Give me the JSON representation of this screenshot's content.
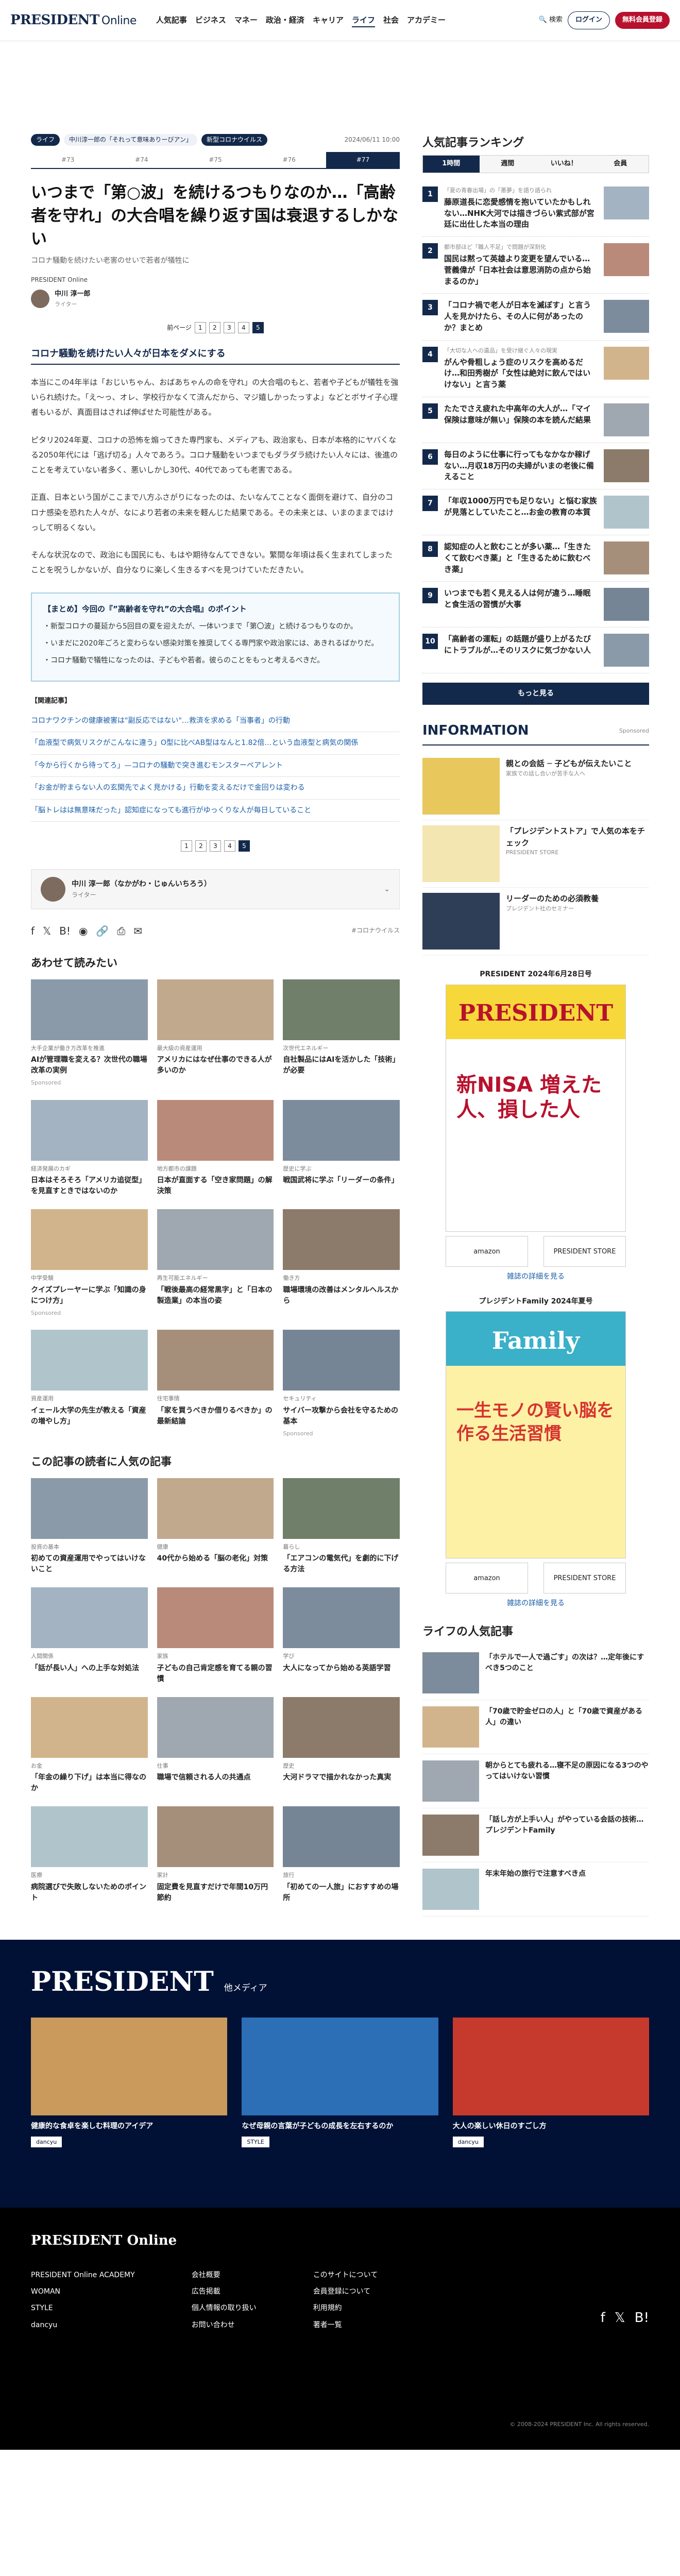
{
  "header": {
    "logo": "PRESIDENT",
    "logo_sub": "Online",
    "nav": [
      "人気記事",
      "ビジネス",
      "マネー",
      "政治・経済",
      "キャリア",
      "ライフ",
      "社会",
      "アカデミー"
    ],
    "nav_active": "ライフ",
    "search": "検索",
    "login": "ログイン",
    "register": "無料会員登録"
  },
  "article": {
    "tags": [
      "ライフ",
      "中川淳一郎の「それって意味ありーびアン」",
      "新型コロナウイルス"
    ],
    "date": "2024/06/11 10:00",
    "page_tabs": [
      "#73",
      "#74",
      "#75",
      "#76",
      "#77"
    ],
    "title": "いつまで「第○波」を続けるつもりなのか…「高齢者を守れ」の大合唱を繰り返す国は衰退するしかない",
    "subtitle": "コロナ騒動を続けたい老害のせいで若者が犠牲に",
    "source": "PRESIDENT Online",
    "author_name": "中川 淳一郎",
    "author_role": "ライター",
    "pager_prev": "前ページ",
    "pages": [
      "1",
      "2",
      "3",
      "4",
      "5"
    ],
    "h2": "コロナ騒動を続けたい人々が日本をダメにする",
    "paragraphs": [
      "本当にこの4年半は「おじいちゃん、おばあちゃんの命を守れ」の大合唱のもと、若者や子どもが犠牲を強いられ続けた。「え〜っ、オレ、学校行かなくて済んだから、マジ嬉しかったっすよ」などとボサイ子心理者もいるが、真面目はされば伸ばせた可能性がある。",
      "ピタリ2024年夏、コロナの恐怖を煽ってきた専門家も、メディアも、政治家も、日本が本格的にヤバくなる2050年代には「逃げ切る」人々であろう。コロナ騒動をいつまでもダラダラ続けたい人々には、後進のことを考えていない者多く、悪いしかし30代、40代であっても老害である。",
      "正直、日本という国がここまで八方ふさがりになったのは、たいなんてことなく面倒を避けて、自分のコロナ感染を恐れた人々が、なにより若者の未来を軽んじた結果である。その未来とは、いまのままではけっして明るくない。",
      "そんな状況なので、政治にも国民にも、もはや期待なんてできない。繁間な年頃は長く生まれてしまったことを呪うしかないが、自分なりに楽しく生きるすべを見つけていただきたい。"
    ],
    "summary_title": "【まとめ】今回の『”高齢者を守れ”の大合唱』のポイント",
    "summary": [
      "・新型コロナの蔓延から5回目の夏を迎えたが、一体いつまで「第〇波」と続けるつもりなのか。",
      "・いまだに2020年ごろと変わらない感染対策を推奨してくる専門家や政治家には、あきれるばかりだ。",
      "・コロナ騒動で犠牲になったのは、子どもや若者。彼らのことをもっと考えるべきだ。"
    ],
    "related_header": "【関連記事】",
    "related": [
      "コロナワクチンの健康被害は\"副反応ではない\"…救済を求める「当事者」の行動",
      "「血液型で病気リスクがこんなに違う」O型に比べAB型はなんと1.82倍…という血液型と病気の関係",
      "「今から行くから待ってろ」—コロナの騒動で突き進むモンスターペアレント",
      "「お金が貯まらない人の玄関先でよく見かける」行動を変えるだけで金回りは変わる",
      "「脳トレはは無意味だった」認知症になっても進行がゆっくりな人が毎日していること"
    ],
    "author_box": "中川 淳一郎（なかがわ・じゅんいちろう）",
    "author_box_role": "ライター",
    "share_tag": "#コロナウイルス"
  },
  "sidebar": {
    "ranking_title": "人気記事ランキング",
    "rank_tabs": [
      "1時間",
      "週間",
      "いいね！",
      "会員"
    ],
    "ranks": [
      {
        "mini": "「夏の青春出場」の「悪夢」を語り語られ",
        "title": "藤原道長に恋愛感情を抱いていたかもしれない…NHK大河では描きづらい紫式部が宮廷に出仕した本当の理由"
      },
      {
        "mini": "都市部ほど「職人不足」で問題が深刻化",
        "title": "国民は黙って英雄より変更を望んでいる…菅義偉が「日本社会は意思消防の点から始まるのか」"
      },
      {
        "mini": "",
        "title": "「コロナ禍で老人が日本を滅ぼす」と言う人を見かけたら、その人に何があったのか？まとめ"
      },
      {
        "mini": "「大切な人への遺品」を受け継ぐ人々の現実",
        "title": "がんや骨粗しょう症のリスクを高めるだけ…和田秀樹が「女性は絶対に飲んではいけない」と言う薬"
      },
      {
        "mini": "",
        "title": "たたでさえ疲れた中高年の大人が…「マイ保険は意味が無い」保険の本を読んだ結果"
      },
      {
        "mini": "",
        "title": "毎日のように仕事に行ってもなかなか稼げない…月収18万円の夫婦がいまの老後に備えること"
      },
      {
        "mini": "",
        "title": "「年収1000万円でも足りない」と悩む家族が見落としていたこと…お金の教育の本質"
      },
      {
        "mini": "",
        "title": "認知症の人と飲むことが多い薬…「生きたくて飲むべき薬」と「生きるために飲むべき薬」"
      },
      {
        "mini": "",
        "title": "いつまでも若く見える人は何が違う…睡眠と食生活の習慣が大事"
      },
      {
        "mini": "",
        "title": "「高齢者の運転」の話題が盛り上がるたびにトラブルが…そのリスクに気づかない人"
      }
    ],
    "more": "もっと見る",
    "info_title": "INFORMATION",
    "info_sponsored": "Sponsored",
    "info": [
      {
        "title": "親との会話 ─ 子どもが伝えたいこと",
        "sub": "家族での話し合いが苦手な人へ"
      },
      {
        "title": "「プレジデントストア」で人気の本をチェック",
        "sub": "PRESIDENT STORE"
      },
      {
        "title": "リーダーのための必須教養",
        "sub": "プレジデント社のセミナー"
      }
    ],
    "mag1_title": "PRESIDENT 2024年6月28日号",
    "mag1_sub": "新NISA 増えた人、損した人",
    "mag2_title": "プレジデントFamily 2024年夏号",
    "mag2_sub": "一生モノの賢い脳を作る生活習慣",
    "store_link": "雑誌の詳細を見る",
    "life_title": "ライフの人気記事",
    "life": [
      {
        "title": "「ホテルで一人で過ごす」の次は？…定年後にすべき5つのこと"
      },
      {
        "title": "「70歳で貯金ゼロの人」と「70歳で資産がある人」の違い"
      },
      {
        "title": "朝からとても疲れる…寝不足の原因になる3つのやってはいけない習慣"
      },
      {
        "title": "「話し方が上手い人」がやっている会話の技術…プレジデントFamily"
      },
      {
        "title": "年末年始の旅行で注意すべき点"
      }
    ]
  },
  "recommend": {
    "title": "あわせて読みたい",
    "cards": [
      {
        "cap": "大手企業が働き方改革を推進",
        "title": "AIが管理職を変える？次世代の職場改革の実例",
        "sp": "Sponsored"
      },
      {
        "cap": "最大級の資産運用",
        "title": "アメリカにはなぜ仕事のできる人が多いのか",
        "sp": ""
      },
      {
        "cap": "次世代エネルギー",
        "title": "自社製品にはAIを活かした「技術」が必要",
        "sp": ""
      },
      {
        "cap": "経済発展のカギ",
        "title": "日本はそろそろ「アメリカ追従型」を見直すときではないのか",
        "sp": ""
      },
      {
        "cap": "地方都市の課題",
        "title": "日本が直面する「空き家問題」の解決策",
        "sp": ""
      },
      {
        "cap": "歴史に学ぶ",
        "title": "戦国武将に学ぶ「リーダーの条件」",
        "sp": ""
      },
      {
        "cap": "中学受験",
        "title": "クイズプレーヤーに学ぶ「知識の身につけ方」",
        "sp": "Sponsored"
      },
      {
        "cap": "再生可能エネルギー",
        "title": "「戦後最高の経常黒字」と「日本の製造業」の本当の姿",
        "sp": ""
      },
      {
        "cap": "働き方",
        "title": "職場環境の改善はメンタルヘルスから",
        "sp": ""
      },
      {
        "cap": "資産運用",
        "title": "イェール大学の先生が教える「資産の増やし方」",
        "sp": ""
      },
      {
        "cap": "住宅事情",
        "title": "「家を買うべきか借りるべきか」の最新結論",
        "sp": ""
      },
      {
        "cap": "セキュリティ",
        "title": "サイバー攻撃から会社を守るための基本",
        "sp": "Sponsored"
      }
    ]
  },
  "readers": {
    "title": "この記事の読者に人気の記事",
    "cards": [
      {
        "cap": "投資の基本",
        "title": "初めての資産運用でやってはいけないこと"
      },
      {
        "cap": "健康",
        "title": "40代から始める「脳の老化」対策"
      },
      {
        "cap": "暮らし",
        "title": "「エアコンの電気代」を劇的に下げる方法"
      },
      {
        "cap": "人間関係",
        "title": "「話が長い人」への上手な対処法"
      },
      {
        "cap": "家族",
        "title": "子どもの自己肯定感を育てる親の習慣"
      },
      {
        "cap": "学び",
        "title": "大人になってから始める英語学習"
      },
      {
        "cap": "お金",
        "title": "「年金の繰り下げ」は本当に得なのか"
      },
      {
        "cap": "仕事",
        "title": "職場で信頼される人の共通点"
      },
      {
        "cap": "歴史",
        "title": "大河ドラマで描かれなかった真実"
      },
      {
        "cap": "医療",
        "title": "病院選びで失敗しないためのポイント"
      },
      {
        "cap": "家計",
        "title": "固定費を見直すだけで年間10万円節約"
      },
      {
        "cap": "旅行",
        "title": "「初めての一人旅」におすすめの場所"
      }
    ]
  },
  "footer": {
    "brand": "PRESIDENT",
    "brand_sub": "他メディア",
    "media": [
      {
        "title": "健康的な食卓を楽しむ料理のアイデア",
        "label": "dancyu"
      },
      {
        "title": "なぜ母親の言葉が子どもの成長を左右するのか",
        "label": "STYLE"
      },
      {
        "title": "大人の楽しい休日のすごし方",
        "label": "dancyu"
      }
    ],
    "footer_logo": "PRESIDENT Online",
    "col1": [
      "PRESIDENT Online ACADEMY",
      "WOMAN",
      "STYLE",
      "dancyu"
    ],
    "col2": [
      "会社概要",
      "広告掲載",
      "個人情報の取り扱い",
      "お問い合わせ"
    ],
    "col3": [
      "このサイトについて",
      "会員登録について",
      "利用規約",
      "著者一覧"
    ],
    "copyright": "© 2008-2024 PRESIDENT Inc. All rights reserved."
  },
  "colors": {
    "brand": "#13294b",
    "accent": "#b8112d"
  }
}
